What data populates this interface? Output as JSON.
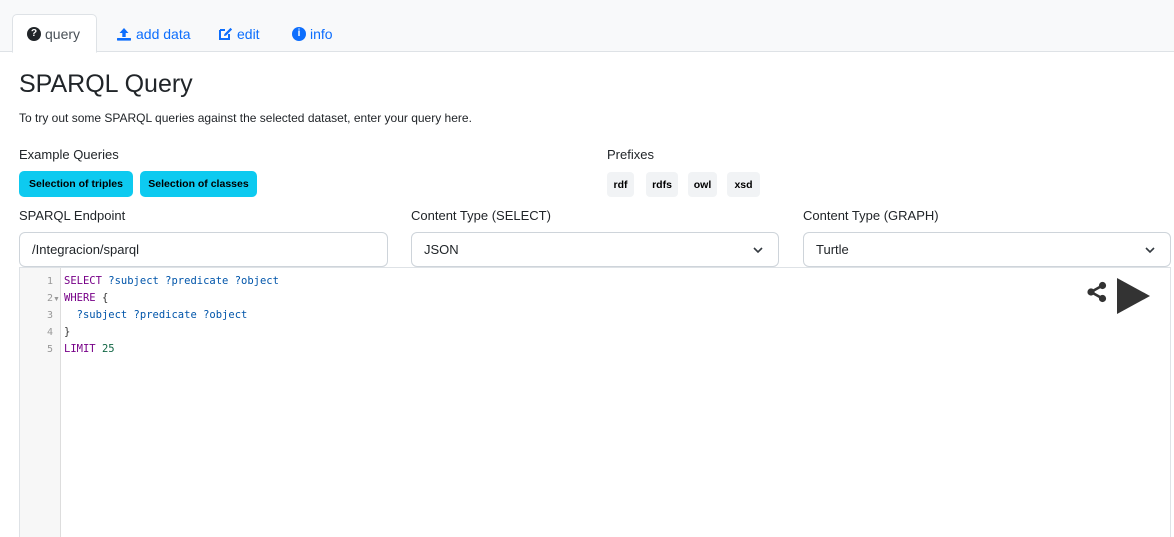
{
  "tabs": [
    {
      "label": "query",
      "icon": "question-circle-icon"
    },
    {
      "label": "add data",
      "icon": "upload-icon"
    },
    {
      "label": "edit",
      "icon": "edit-icon"
    },
    {
      "label": "info",
      "icon": "info-circle-icon"
    }
  ],
  "page": {
    "title": "SPARQL Query",
    "description": "To try out some SPARQL queries against the selected dataset, enter your query here."
  },
  "examples": {
    "label": "Example Queries",
    "buttons": [
      "Selection of triples",
      "Selection of classes"
    ]
  },
  "prefixes": {
    "label": "Prefixes",
    "items": [
      "rdf",
      "rdfs",
      "owl",
      "xsd"
    ]
  },
  "endpoint": {
    "label": "SPARQL Endpoint",
    "value": "/Integracion/sparql"
  },
  "content_select": {
    "label": "Content Type (SELECT)",
    "value": "JSON"
  },
  "content_graph": {
    "label": "Content Type (GRAPH)",
    "value": "Turtle"
  },
  "editor": {
    "line_numbers": [
      "1",
      "2",
      "3",
      "4",
      "5"
    ],
    "lines": [
      {
        "kw": "SELECT",
        "rest": "?subject ?predicate ?object"
      },
      {
        "kw": "WHERE",
        "rest": "{"
      },
      {
        "kw": "",
        "rest": "?subject ?predicate ?object"
      },
      {
        "kw": "",
        "rest": "}"
      },
      {
        "kw": "LIMIT",
        "rest": "25"
      }
    ]
  },
  "colors": {
    "accent": "#0d6efd",
    "example_button": "#0dcaf0",
    "keyword": "#770088",
    "variable": "#0055aa"
  }
}
